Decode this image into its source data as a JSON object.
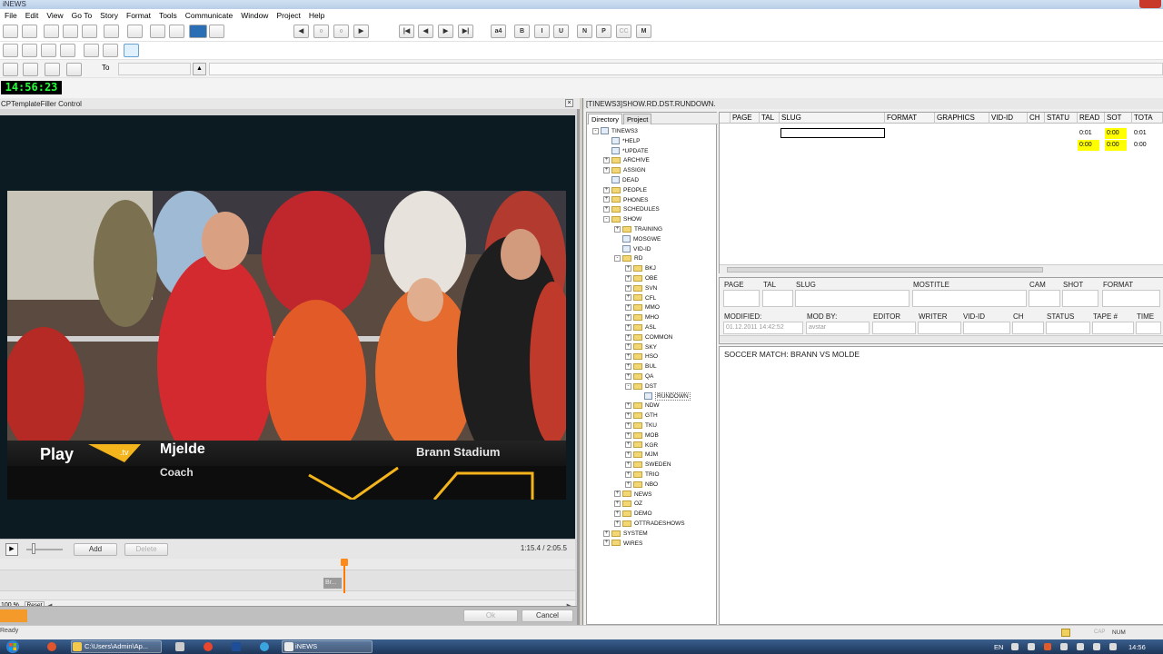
{
  "app": {
    "title": "iNEWS"
  },
  "menu": [
    "File",
    "Edit",
    "View",
    "Go To",
    "Story",
    "Format",
    "Tools",
    "Communicate",
    "Window",
    "Project",
    "Help"
  ],
  "toolbar": {
    "format_buttons": [
      "a4",
      "B",
      "I",
      "U",
      "N",
      "P",
      "CC",
      "M"
    ],
    "to_label": "To"
  },
  "clock": "14:56:23",
  "left_panel": {
    "title": "CPTemplateFiller Control",
    "lower_third": {
      "brand": "Play",
      "logo_suffix": ".tv",
      "name": "Mjelde",
      "role": "Coach",
      "location": "Brann Stadium"
    },
    "add_label": "Add",
    "delete_label": "Delete",
    "timecode": "1:15.4 / 2:05.5",
    "clip_label": "Br...",
    "zoom": "100 %",
    "reset_label": "Reset",
    "ok_label": "Ok",
    "cancel_label": "Cancel"
  },
  "right_panel": {
    "title": "[TINEWS3]SHOW.RD.DST.RUNDOWN.",
    "tabs": [
      "Directory",
      "Project"
    ],
    "tree": [
      {
        "label": "TINEWS3",
        "depth": 0,
        "icon": "computer",
        "expander": "-"
      },
      {
        "label": "*HELP",
        "depth": 1,
        "icon": "queue",
        "expander": ""
      },
      {
        "label": "*UPDATE",
        "depth": 1,
        "icon": "queue",
        "expander": ""
      },
      {
        "label": "ARCHIVE",
        "depth": 1,
        "icon": "folder",
        "expander": "+"
      },
      {
        "label": "ASSIGN",
        "depth": 1,
        "icon": "folder",
        "expander": "+"
      },
      {
        "label": "DEAD",
        "depth": 1,
        "icon": "queue",
        "expander": ""
      },
      {
        "label": "PEOPLE",
        "depth": 1,
        "icon": "folder",
        "expander": "+"
      },
      {
        "label": "PHONES",
        "depth": 1,
        "icon": "folder",
        "expander": "+"
      },
      {
        "label": "SCHEDULES",
        "depth": 1,
        "icon": "folder",
        "expander": "+"
      },
      {
        "label": "SHOW",
        "depth": 1,
        "icon": "folder",
        "expander": "-"
      },
      {
        "label": "TRAINING",
        "depth": 2,
        "icon": "folder",
        "expander": "+"
      },
      {
        "label": "MOSGWE",
        "depth": 2,
        "icon": "queue",
        "expander": ""
      },
      {
        "label": "VID-ID",
        "depth": 2,
        "icon": "queue",
        "expander": ""
      },
      {
        "label": "RD",
        "depth": 2,
        "icon": "folder",
        "expander": "-"
      },
      {
        "label": "BKJ",
        "depth": 3,
        "icon": "folder",
        "expander": "+"
      },
      {
        "label": "OBE",
        "depth": 3,
        "icon": "folder",
        "expander": "+"
      },
      {
        "label": "SVN",
        "depth": 3,
        "icon": "folder",
        "expander": "+"
      },
      {
        "label": "CFL",
        "depth": 3,
        "icon": "folder",
        "expander": "+"
      },
      {
        "label": "MMO",
        "depth": 3,
        "icon": "folder",
        "expander": "+"
      },
      {
        "label": "MHO",
        "depth": 3,
        "icon": "folder",
        "expander": "+"
      },
      {
        "label": "ASL",
        "depth": 3,
        "icon": "folder",
        "expander": "+"
      },
      {
        "label": "COMMON",
        "depth": 3,
        "icon": "folder",
        "expander": "+"
      },
      {
        "label": "SKY",
        "depth": 3,
        "icon": "folder",
        "expander": "+"
      },
      {
        "label": "HSO",
        "depth": 3,
        "icon": "folder",
        "expander": "+"
      },
      {
        "label": "BUL",
        "depth": 3,
        "icon": "folder",
        "expander": "+"
      },
      {
        "label": "QA",
        "depth": 3,
        "icon": "folder",
        "expander": "+"
      },
      {
        "label": "DST",
        "depth": 3,
        "icon": "folder",
        "expander": "-"
      },
      {
        "label": "RUNDOWN",
        "depth": 4,
        "icon": "queue",
        "expander": "",
        "selected": true
      },
      {
        "label": "NDW",
        "depth": 3,
        "icon": "folder",
        "expander": "+"
      },
      {
        "label": "GTH",
        "depth": 3,
        "icon": "folder",
        "expander": "+"
      },
      {
        "label": "TKU",
        "depth": 3,
        "icon": "folder",
        "expander": "+"
      },
      {
        "label": "MOB",
        "depth": 3,
        "icon": "folder",
        "expander": "+"
      },
      {
        "label": "KGR",
        "depth": 3,
        "icon": "folder",
        "expander": "+"
      },
      {
        "label": "MJM",
        "depth": 3,
        "icon": "folder",
        "expander": "+"
      },
      {
        "label": "SWEDEN",
        "depth": 3,
        "icon": "folder",
        "expander": "+"
      },
      {
        "label": "TRIO",
        "depth": 3,
        "icon": "folder",
        "expander": "+"
      },
      {
        "label": "NBO",
        "depth": 3,
        "icon": "folder",
        "expander": "+"
      },
      {
        "label": "NEWS",
        "depth": 2,
        "icon": "folder",
        "expander": "+"
      },
      {
        "label": "OZ",
        "depth": 2,
        "icon": "folder",
        "expander": "+"
      },
      {
        "label": "DEMO",
        "depth": 2,
        "icon": "folder",
        "expander": "+"
      },
      {
        "label": "OTTRADESHOWS",
        "depth": 2,
        "icon": "folder",
        "expander": "+"
      },
      {
        "label": "SYSTEM",
        "depth": 1,
        "icon": "folder",
        "expander": "+"
      },
      {
        "label": "WIRES",
        "depth": 1,
        "icon": "folder",
        "expander": "+"
      }
    ],
    "grid": {
      "columns": [
        "PAGE",
        "TAL",
        "SLUG",
        "FORMAT",
        "GRAPHICS",
        "VID-ID",
        "CH",
        "STATU",
        "READ",
        "SOT",
        "TOTA"
      ],
      "rows": [
        {
          "read": "0:01",
          "sot": "0:00",
          "total": "0:01"
        },
        {
          "read": "0:00",
          "sot": "0:00",
          "total": "0:00"
        }
      ]
    },
    "form": {
      "row1": [
        "PAGE",
        "TAL",
        "SLUG",
        "MOSTITLE",
        "CAM",
        "SHOT",
        "FORMAT"
      ],
      "row2": [
        "MODIFIED:",
        "MOD BY:",
        "EDITOR",
        "WRITER",
        "VID-ID",
        "CH",
        "STATUS",
        "TAPE #",
        "TIME"
      ],
      "modified_value": "01.12.2011 14:42:52",
      "mod_by_value": "avstar"
    },
    "story_text": "SOCCER MATCH: BRANN VS MOLDE"
  },
  "status": {
    "left": "Ready",
    "cap": "CAP",
    "num": "NUM"
  },
  "taskbar": {
    "items": [
      "C:\\Users\\Admin\\Ap...",
      "iNEWS"
    ],
    "lang": "EN",
    "time": "14:56"
  },
  "colors": {
    "accent_orange": "#ff8a1a",
    "clock_green": "#24ff3a",
    "highlight_yellow": "#ffff00"
  }
}
